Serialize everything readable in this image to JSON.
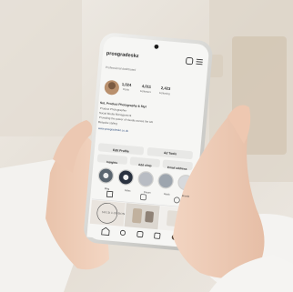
{
  "profile": {
    "username": "prosgradeskz",
    "category": "Professional dashboard",
    "display_name": "SoL Product Photography & Styl",
    "stats": [
      {
        "value": "1,024",
        "label": "Posts"
      },
      {
        "value": "4,011",
        "label": "Followers"
      },
      {
        "value": "2,423",
        "label": "Following"
      }
    ],
    "bio_lines": [
      "Product Photographer",
      "Social Media Management",
      "Providing the power of visuals across the UK",
      "Bespoke styling"
    ],
    "link": "www.prosgradeskz.co.uk"
  },
  "actions": {
    "edit_profile": "Edit Profile",
    "ad_tools": "Ad Tools",
    "insights": "Insights",
    "add_shop": "Add shop",
    "email_address": "Email address"
  },
  "highlights": [
    "Blog",
    "Sales",
    "Dream",
    "Reels",
    "Brands"
  ],
  "post_text": "SOLD LONDON",
  "colors": {
    "backdrop": "#e9e5df",
    "phone_frame": "#d9d9d6",
    "screen_bg": "#f6f6f4",
    "button_bg": "#e8e8e6"
  },
  "icons": [
    "plus-icon",
    "menu-icon",
    "grid-icon",
    "reels-icon",
    "tag-icon",
    "home-icon",
    "search-icon",
    "add-post-icon",
    "shop-icon",
    "profile-icon"
  ]
}
